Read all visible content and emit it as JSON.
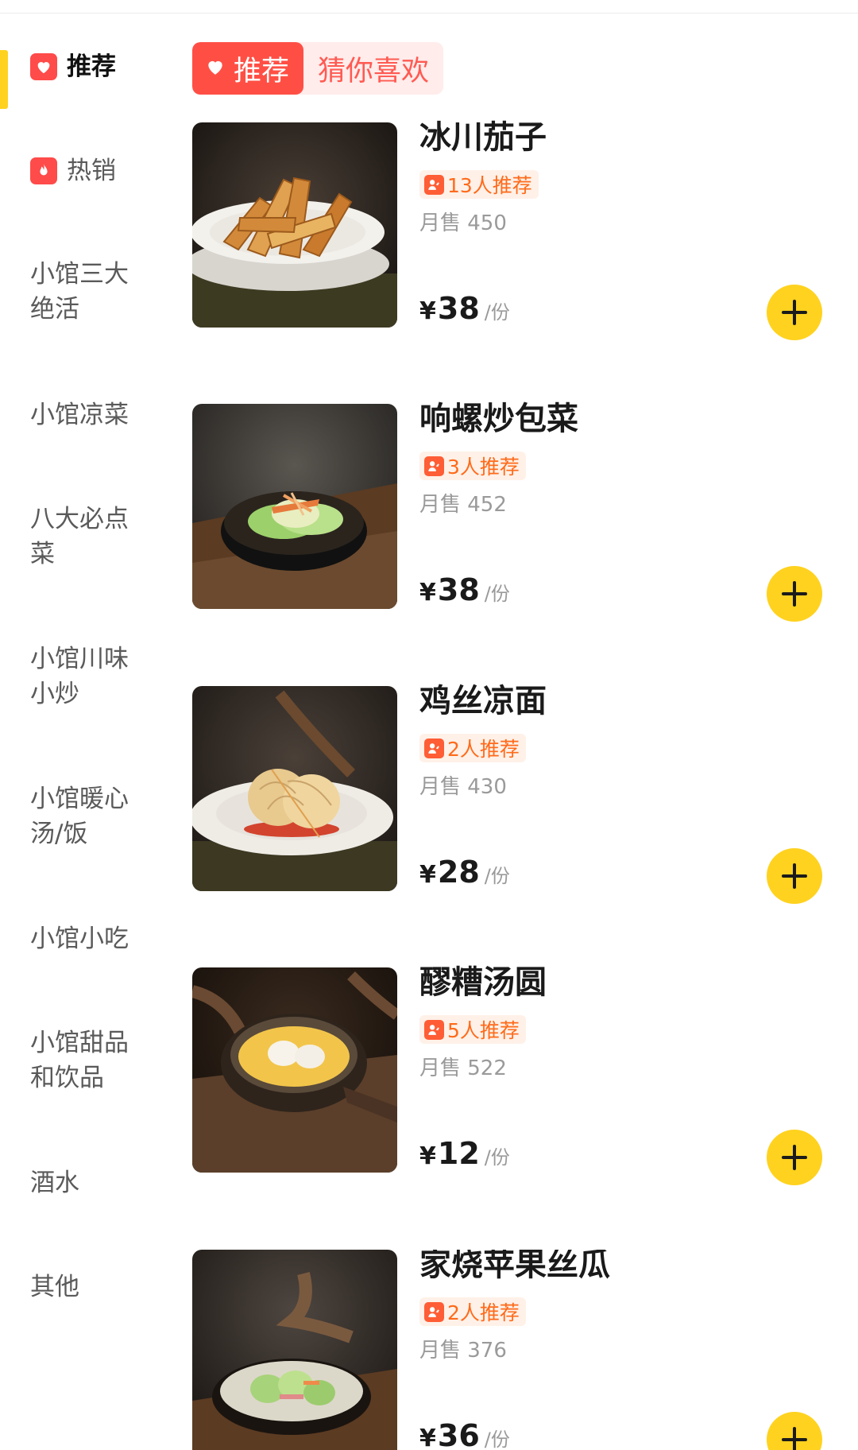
{
  "sidebar": {
    "categories": [
      {
        "label": "推荐",
        "icon": "heart-icon",
        "active": true
      },
      {
        "label": "热销",
        "icon": "flame-icon"
      },
      {
        "label": "小馆三大",
        "label2": "绝活"
      },
      {
        "label": "小馆凉菜"
      },
      {
        "label": "八大必点",
        "label2": "菜"
      },
      {
        "label": "小馆川味",
        "label2": "小炒"
      },
      {
        "label": "小馆暖心",
        "label2": "汤/饭"
      },
      {
        "label": "小馆小吃"
      },
      {
        "label": "小馆甜品",
        "label2": "和饮品"
      },
      {
        "label": "酒水"
      },
      {
        "label": "其他"
      }
    ]
  },
  "tabs": [
    {
      "label": "推荐",
      "icon": "heart-icon",
      "active": true
    },
    {
      "label": "猜你喜欢"
    }
  ],
  "items": [
    {
      "name": "冰川茄子",
      "recommend": "13人推荐",
      "sales": "月售 450",
      "currency": "¥",
      "price": "38",
      "unit": "/份"
    },
    {
      "name": "响螺炒包菜",
      "recommend": "3人推荐",
      "sales": "月售 452",
      "currency": "¥",
      "price": "38",
      "unit": "/份"
    },
    {
      "name": "鸡丝凉面",
      "recommend": "2人推荐",
      "sales": "月售 430",
      "currency": "¥",
      "price": "28",
      "unit": "/份"
    },
    {
      "name": "醪糟汤圆",
      "recommend": "5人推荐",
      "sales": "月售 522",
      "currency": "¥",
      "price": "12",
      "unit": "/份"
    },
    {
      "name": "家烧苹果丝瓜",
      "recommend": "2人推荐",
      "sales": "月售 376",
      "currency": "¥",
      "price": "36",
      "unit": "/份"
    }
  ],
  "colors": {
    "accent_yellow": "#ffd21f",
    "tab_red": "#ff4f45",
    "recommend_orange": "#ff6a1a"
  }
}
